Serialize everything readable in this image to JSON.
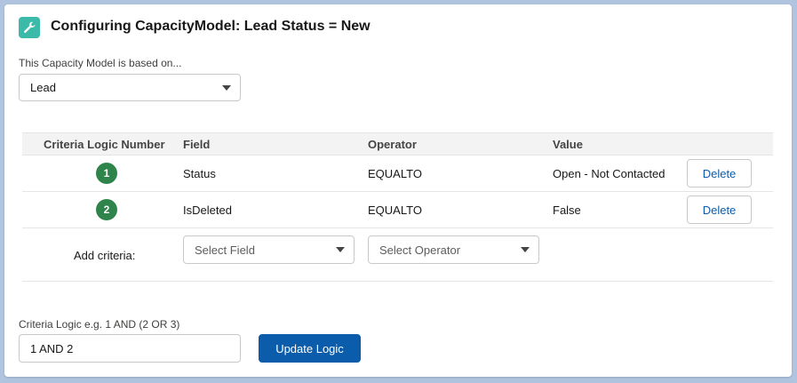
{
  "header": {
    "title": "Configuring CapacityModel: Lead Status = New",
    "icon": "wrench-icon"
  },
  "based_on": {
    "label": "This Capacity Model is based on...",
    "value": "Lead"
  },
  "criteria_table": {
    "columns": [
      "Criteria Logic Number",
      "Field",
      "Operator",
      "Value"
    ],
    "rows": [
      {
        "number": "1",
        "field": "Status",
        "operator": "EQUALTO",
        "value": "Open - Not Contacted",
        "action": "Delete"
      },
      {
        "number": "2",
        "field": "IsDeleted",
        "operator": "EQUALTO",
        "value": "False",
        "action": "Delete"
      }
    ]
  },
  "add_criteria": {
    "label": "Add criteria:",
    "field_placeholder": "Select Field",
    "operator_placeholder": "Select Operator"
  },
  "criteria_logic": {
    "label": "Criteria Logic e.g. 1 AND (2 OR 3)",
    "value": "1 AND 2",
    "button": "Update Logic"
  },
  "colors": {
    "accent": "#0b5cab",
    "badge": "#2e844a",
    "icon_bg": "#3bbaa9",
    "background": "#b0c4df"
  }
}
